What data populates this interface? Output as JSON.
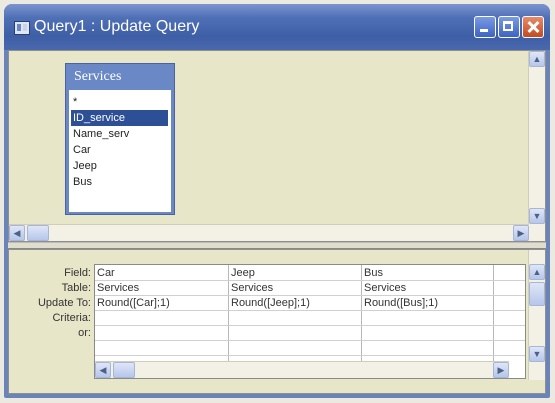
{
  "window": {
    "title": "Query1 : Update Query"
  },
  "table": {
    "name": "Services",
    "fields": [
      "*",
      "ID_service",
      "Name_serv",
      "Car",
      "Jeep",
      "Bus"
    ],
    "selected_field": "ID_service"
  },
  "design_grid": {
    "row_labels": {
      "field": "Field:",
      "table": "Table:",
      "update_to": "Update To:",
      "criteria": "Criteria:",
      "or": "or:"
    },
    "columns": [
      {
        "field": "Car",
        "table": "Services",
        "update_to": "Round([Car];1)"
      },
      {
        "field": "Jeep",
        "table": "Services",
        "update_to": "Round([Jeep];1)"
      },
      {
        "field": "Bus",
        "table": "Services",
        "update_to": "Round([Bus];1)"
      }
    ]
  },
  "icons": {
    "title": "query-icon",
    "minimize": "minimize-icon",
    "maximize": "maximize-icon",
    "close": "close-icon"
  },
  "colors": {
    "titlebar": "#3e5ea6",
    "field_list_header": "#6a87c6",
    "selected": "#2d4f96",
    "pane_bg": "#e8e6c9"
  }
}
